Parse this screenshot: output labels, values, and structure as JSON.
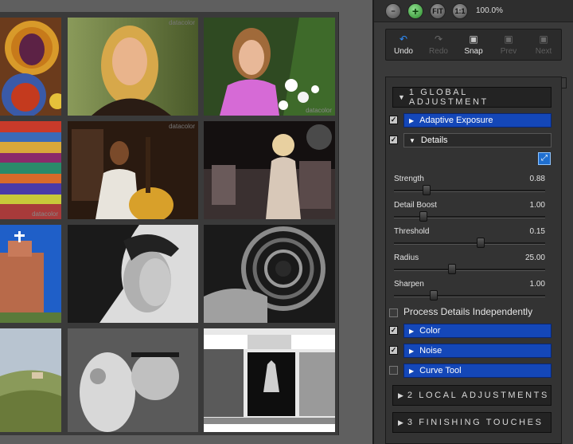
{
  "viewer": {
    "watermark": "datacolor",
    "tiles": [
      {
        "id": "fruit-plates"
      },
      {
        "id": "blonde-woman-portrait"
      },
      {
        "id": "girl-with-flowers"
      },
      {
        "id": "colorful-fabrics"
      },
      {
        "id": "guitar-player"
      },
      {
        "id": "woman-on-stage"
      },
      {
        "id": "adobe-church"
      },
      {
        "id": "bw-woman-profile"
      },
      {
        "id": "spiral-staircase"
      },
      {
        "id": "tuscan-landscape"
      },
      {
        "id": "bw-scooter"
      },
      {
        "id": "bw-test-chart"
      }
    ]
  },
  "zoom": {
    "zoom_out_icon": "minus-icon",
    "zoom_in_icon": "plus-icon",
    "fit_label": "FIT",
    "one_to_one_label": "1:1",
    "level": "100.0%"
  },
  "history": {
    "undo": "Undo",
    "redo": "Redo",
    "snap": "Snap",
    "prev": "Prev",
    "next": "Next"
  },
  "global": {
    "header": "1 GLOBAL ADJUSTMENT",
    "adaptive_exposure": "Adaptive Exposure",
    "details": "Details",
    "sliders": [
      {
        "label": "Strength",
        "value": "0.88",
        "level": 0.2
      },
      {
        "label": "Detail Boost",
        "value": "1.00",
        "level": 0.18
      },
      {
        "label": "Threshold",
        "value": "0.15",
        "level": 0.58
      },
      {
        "label": "Radius",
        "value": "25.00",
        "level": 0.38
      },
      {
        "label": "Sharpen",
        "value": "1.00",
        "level": 0.25
      }
    ],
    "process_details_independently": "Process Details Independently",
    "color": "Color",
    "noise": "Noise",
    "curve_tool": "Curve Tool"
  },
  "local": {
    "header": "2 LOCAL ADJUSTMENTS"
  },
  "finishing": {
    "header": "3 FINISHING TOUCHES"
  },
  "colors": {
    "accent_blue": "#1447b8",
    "panel_bg": "#3a3a3a",
    "zoom_in_green": "#2a8a2a"
  }
}
